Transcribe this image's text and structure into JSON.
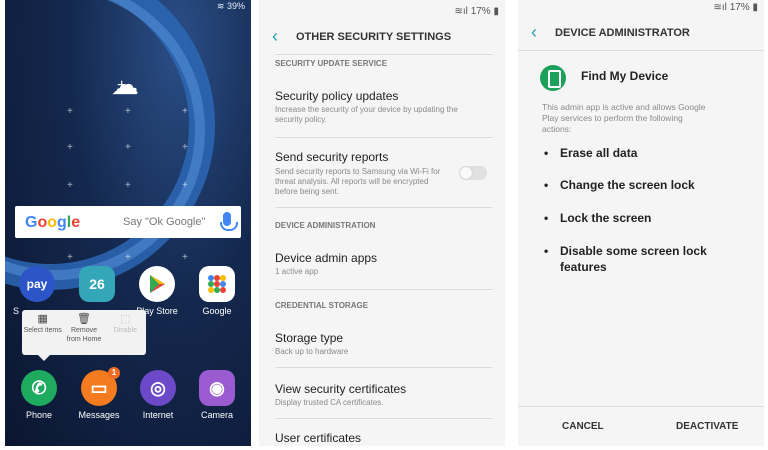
{
  "home": {
    "status_text": "39%",
    "search_logo": [
      "G",
      "o",
      "o",
      "g",
      "l",
      "e"
    ],
    "search_hint": "Say \"Ok Google\"",
    "apps_row1": [
      {
        "label": "Samsung Pay",
        "icon": "pay",
        "color": "#2c56c7"
      },
      {
        "label": "Calendar",
        "icon": "26",
        "color": "#33a6b8"
      },
      {
        "label": "Play Store",
        "icon": "play-icon",
        "color": "#ffffff"
      },
      {
        "label": "Google",
        "icon": "google-folder",
        "color": "#ffffff"
      }
    ],
    "visible_labels_row1": [
      "S",
      "",
      "Play Store",
      "Google"
    ],
    "popup": [
      {
        "label": "Select items",
        "icon": "▦",
        "disabled": false
      },
      {
        "label": "Remove from Home",
        "icon": "🗑",
        "disabled": false
      },
      {
        "label": "Disable",
        "icon": "⬚",
        "disabled": true
      }
    ],
    "dock": [
      {
        "label": "Phone",
        "icon": "✆",
        "color": "#1eaa5f"
      },
      {
        "label": "Messages",
        "icon": "▭",
        "color": "#f47b20",
        "badge": "1"
      },
      {
        "label": "Internet",
        "icon": "◎",
        "color": "#6c49c9"
      },
      {
        "label": "Camera",
        "icon": "◉",
        "color": "#9a5bd0"
      }
    ]
  },
  "security": {
    "status_text": "17%",
    "title": "OTHER SECURITY SETTINGS",
    "section_update": "SECURITY UPDATE SERVICE",
    "policy_title": "Security policy updates",
    "policy_sub": "Increase the security of your device by updating the security policy.",
    "reports_title": "Send security reports",
    "reports_sub": "Send security reports to Samsung via Wi-Fi for threat analysis. All reports will be encrypted before being sent.",
    "section_admin": "DEVICE ADMINISTRATION",
    "admin_title": "Device admin apps",
    "admin_sub": "1 active app",
    "section_cred": "CREDENTIAL STORAGE",
    "storage_title": "Storage type",
    "storage_sub": "Back up to hardware",
    "certs_title": "View security certificates",
    "certs_sub": "Display trusted CA certificates.",
    "user_certs_title": "User certificates"
  },
  "devadmin": {
    "status_text": "17%",
    "title": "DEVICE ADMINISTRATOR",
    "app_name": "Find My Device",
    "description": "This admin app is active and allows Google Play services to perform the following actions:",
    "actions": [
      "Erase all data",
      "Change the screen lock",
      "Lock the screen",
      "Disable some screen lock features"
    ],
    "cancel_label": "CANCEL",
    "deactivate_label": "DEACTIVATE"
  }
}
